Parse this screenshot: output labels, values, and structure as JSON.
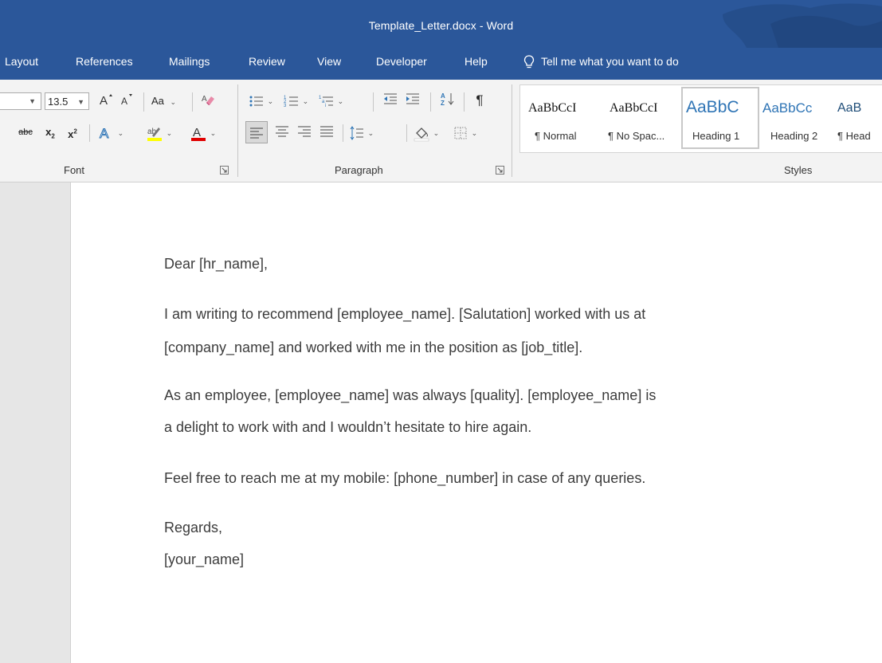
{
  "window": {
    "title": "Template_Letter.docx  -  Word"
  },
  "menu": {
    "tabs": [
      "Layout",
      "References",
      "Mailings",
      "Review",
      "View",
      "Developer",
      "Help"
    ],
    "tell_me": "Tell me what you want to do"
  },
  "ribbon": {
    "font": {
      "size": "13.5",
      "change_case": "Aa",
      "group_label": "Font"
    },
    "paragraph": {
      "group_label": "Paragraph"
    },
    "styles": {
      "group_label": "Styles",
      "items": [
        {
          "sample": "AaBbCcI",
          "name": "¶ Normal"
        },
        {
          "sample": "AaBbCcI",
          "name": "¶ No Spac..."
        },
        {
          "sample": "AaBbC",
          "name": "Heading 1"
        },
        {
          "sample": "AaBbCc",
          "name": "Heading 2"
        },
        {
          "sample": "AaB",
          "name": "¶ Head"
        }
      ],
      "selected_index": 2
    }
  },
  "document": {
    "paragraphs": [
      "Dear [hr_name],",
      "I am writing to recommend [employee_name]. [Salutation] worked with us at",
      "[company_name] and worked with me in the position as [job_title].",
      "As an employee, [employee_name] was always [quality]. [employee_name] is",
      "a delight to work with and I wouldn’t hesitate to hire again.",
      "Feel free to reach me at my mobile: [phone_number] in case of any queries.",
      "Regards,",
      "[your_name]"
    ]
  },
  "colors": {
    "title_bar": "#2b579a",
    "ribbon_bg": "#f3f3f3",
    "highlight_yellow": "#ffff00",
    "font_color_red": "#e00000",
    "heading_blue": "#2e74b5"
  }
}
